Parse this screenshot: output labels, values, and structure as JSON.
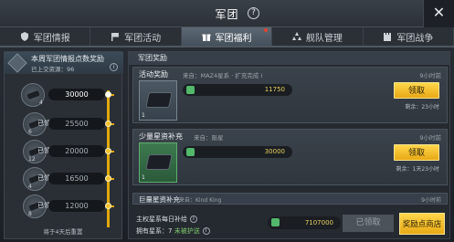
{
  "header": {
    "title": "军团",
    "help_glyph": "?",
    "close_glyph": "✕"
  },
  "tabs": [
    {
      "label": "军团情报",
      "icon": "shield-icon"
    },
    {
      "label": "军团活动",
      "icon": "flag-icon"
    },
    {
      "label": "军团福利",
      "icon": "gift-icon",
      "active": true
    },
    {
      "label": "舰队管理",
      "icon": "fleet-icon"
    },
    {
      "label": "军团战争",
      "icon": "castle-icon"
    }
  ],
  "left": {
    "title": "本周军团情报点数奖励",
    "subtitle": "已上交资源：96",
    "info_glyph": "i",
    "milestones": [
      {
        "value": "30000",
        "count": "4",
        "claimed": ""
      },
      {
        "value": "25500",
        "count": "6",
        "claimed": "已领取"
      },
      {
        "value": "20000",
        "count": "12",
        "claimed": "已领取"
      },
      {
        "value": "16500",
        "count": "4",
        "claimed": "已领取"
      },
      {
        "value": "12000",
        "count": "8",
        "claimed": "已领取"
      }
    ],
    "footer": "将于4天后重置"
  },
  "right": {
    "section_title": "军团奖励",
    "rewards": [
      {
        "title": "活动奖励",
        "meta": "来自：MAZ4星系 · 扩充完成 I",
        "time": "9小时前",
        "quantity": "1",
        "resource_value": "11750",
        "claim_label": "领取",
        "remain": "剩余：23小时"
      },
      {
        "title": "少量星资补充",
        "meta": "来自：陨星",
        "time": "9小时前",
        "quantity": "1",
        "resource_value": "30000",
        "claim_label": "领取",
        "remain": "剩余：1天23小时"
      }
    ],
    "big_supply": {
      "title": "巨量星资补充",
      "meta": "来自：Kind King",
      "time": "9小时前"
    },
    "daily": {
      "line1": "主权星系每日补给",
      "line2_prefix": "拥有星系：",
      "line2_value": "7",
      "line2_suffix": "未被护送",
      "resource_value": "7107000",
      "claimed_label": "已领取",
      "shop_label": "奖励点商店"
    }
  }
}
